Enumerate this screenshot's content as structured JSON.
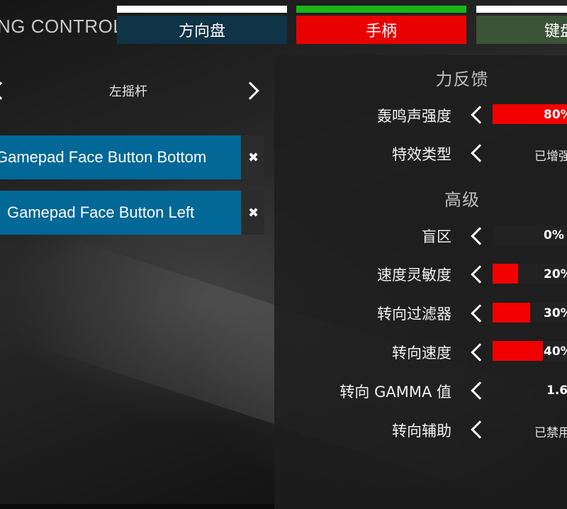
{
  "header": {
    "title": "NG CONTROL",
    "tabs": [
      {
        "label": "方向盘"
      },
      {
        "label": "手柄"
      },
      {
        "label": "键盘"
      }
    ]
  },
  "left": {
    "stick_label": "左摇杆",
    "bindings": [
      {
        "label": "Gamepad Face Button Bottom",
        "remove": "✖"
      },
      {
        "label": "Gamepad Face Button Left",
        "remove": "✖"
      }
    ]
  },
  "right": {
    "force_feedback": {
      "title": "力反馈",
      "rumble": {
        "label": "轰鸣声强度",
        "percent": 80,
        "value_text": "80%"
      },
      "effect_type": {
        "label": "特效类型",
        "value_text": "已增强"
      }
    },
    "advanced": {
      "title": "高级",
      "deadzone": {
        "label": "盲区",
        "percent": 0,
        "value_text": "0%"
      },
      "speed_sensitivity": {
        "label": "速度灵敏度",
        "percent": 20,
        "value_text": "20%"
      },
      "steering_filter": {
        "label": "转向过滤器",
        "percent": 30,
        "value_text": "30%"
      },
      "steering_speed": {
        "label": "转向速度",
        "percent": 40,
        "value_text": "40%"
      },
      "steering_gamma": {
        "label": "转向 GAMMA 值",
        "value_text": "1.6"
      },
      "steering_assist": {
        "label": "转向辅助",
        "value_text": "已禁用"
      }
    }
  },
  "colors": {
    "accent_red": "#f20000",
    "tab_wheel_bg": "#0f3347",
    "tab_gamepad_bg": "#e90000",
    "tab_keyboard_bg": "#3b5336",
    "binding_bg": "#016898"
  }
}
